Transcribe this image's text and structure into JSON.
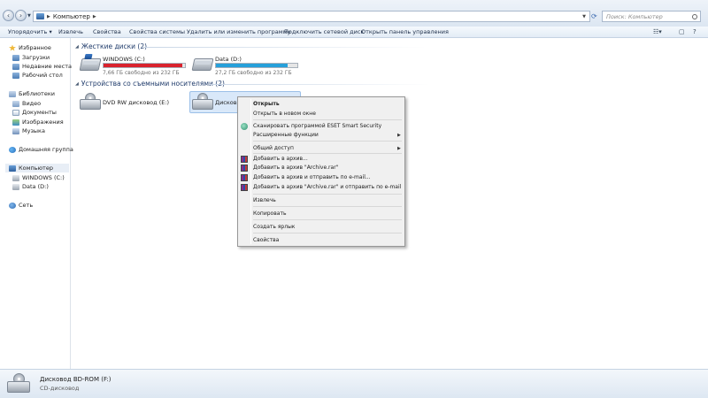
{
  "address": {
    "crumb": "Компьютер",
    "search_placeholder": "Поиск: Компьютер"
  },
  "toolbar": {
    "organize": "Упорядочить",
    "eject": "Извлечь",
    "properties": "Свойства",
    "system_properties": "Свойства системы",
    "uninstall": "Удалить или изменить программу",
    "map_drive": "Подключить сетевой диск",
    "control_panel": "Открыть панель управления"
  },
  "nav": {
    "favorites": "Избранное",
    "downloads": "Загрузки",
    "recent": "Недавние места",
    "desktop": "Рабочий стол",
    "libraries": "Библиотеки",
    "video": "Видео",
    "documents": "Документы",
    "images": "Изображения",
    "music": "Музыка",
    "homegroup": "Домашняя группа",
    "computer": "Компьютер",
    "drive_c": "WINDOWS (C:)",
    "drive_d": "Data (D:)",
    "network": "Сеть"
  },
  "content": {
    "hdd_group": "Жесткие диски (2)",
    "removable_group": "Устройства со съемными носителями (2)",
    "drives": [
      {
        "name": "WINDOWS (C:)",
        "free": "7,66 ГБ свободно из 232 ГБ",
        "used_fraction": 0.97,
        "bar_color": "#d9232e"
      },
      {
        "name": "Data (D:)",
        "free": "27,2 ГБ свободно из 232 ГБ",
        "used_fraction": 0.88,
        "bar_color": "#26a0da"
      }
    ],
    "dvd_name": "DVD RW дисковод (E:)",
    "bd_name": "Дисковод"
  },
  "context_menu": {
    "open": "Открыть",
    "open_new_window": "Открыть в новом окне",
    "eset_scan": "Сканировать программой ESET Smart Security",
    "advanced": "Расширенные функции",
    "share": "Общий доступ",
    "add_archive": "Добавить в архив...",
    "add_archive_rar": "Добавить в архив \"Archive.rar\"",
    "add_archive_email": "Добавить в архив и отправить по e-mail...",
    "add_archive_rar_email": "Добавить в архив \"Archive.rar\" и отправить по e-mail",
    "eject": "Извлечь",
    "copy": "Копировать",
    "create_shortcut": "Создать ярлык",
    "properties": "Свойства"
  },
  "details": {
    "name": "Дисковод BD-ROM (F:)",
    "type": "CD-дисковод"
  }
}
